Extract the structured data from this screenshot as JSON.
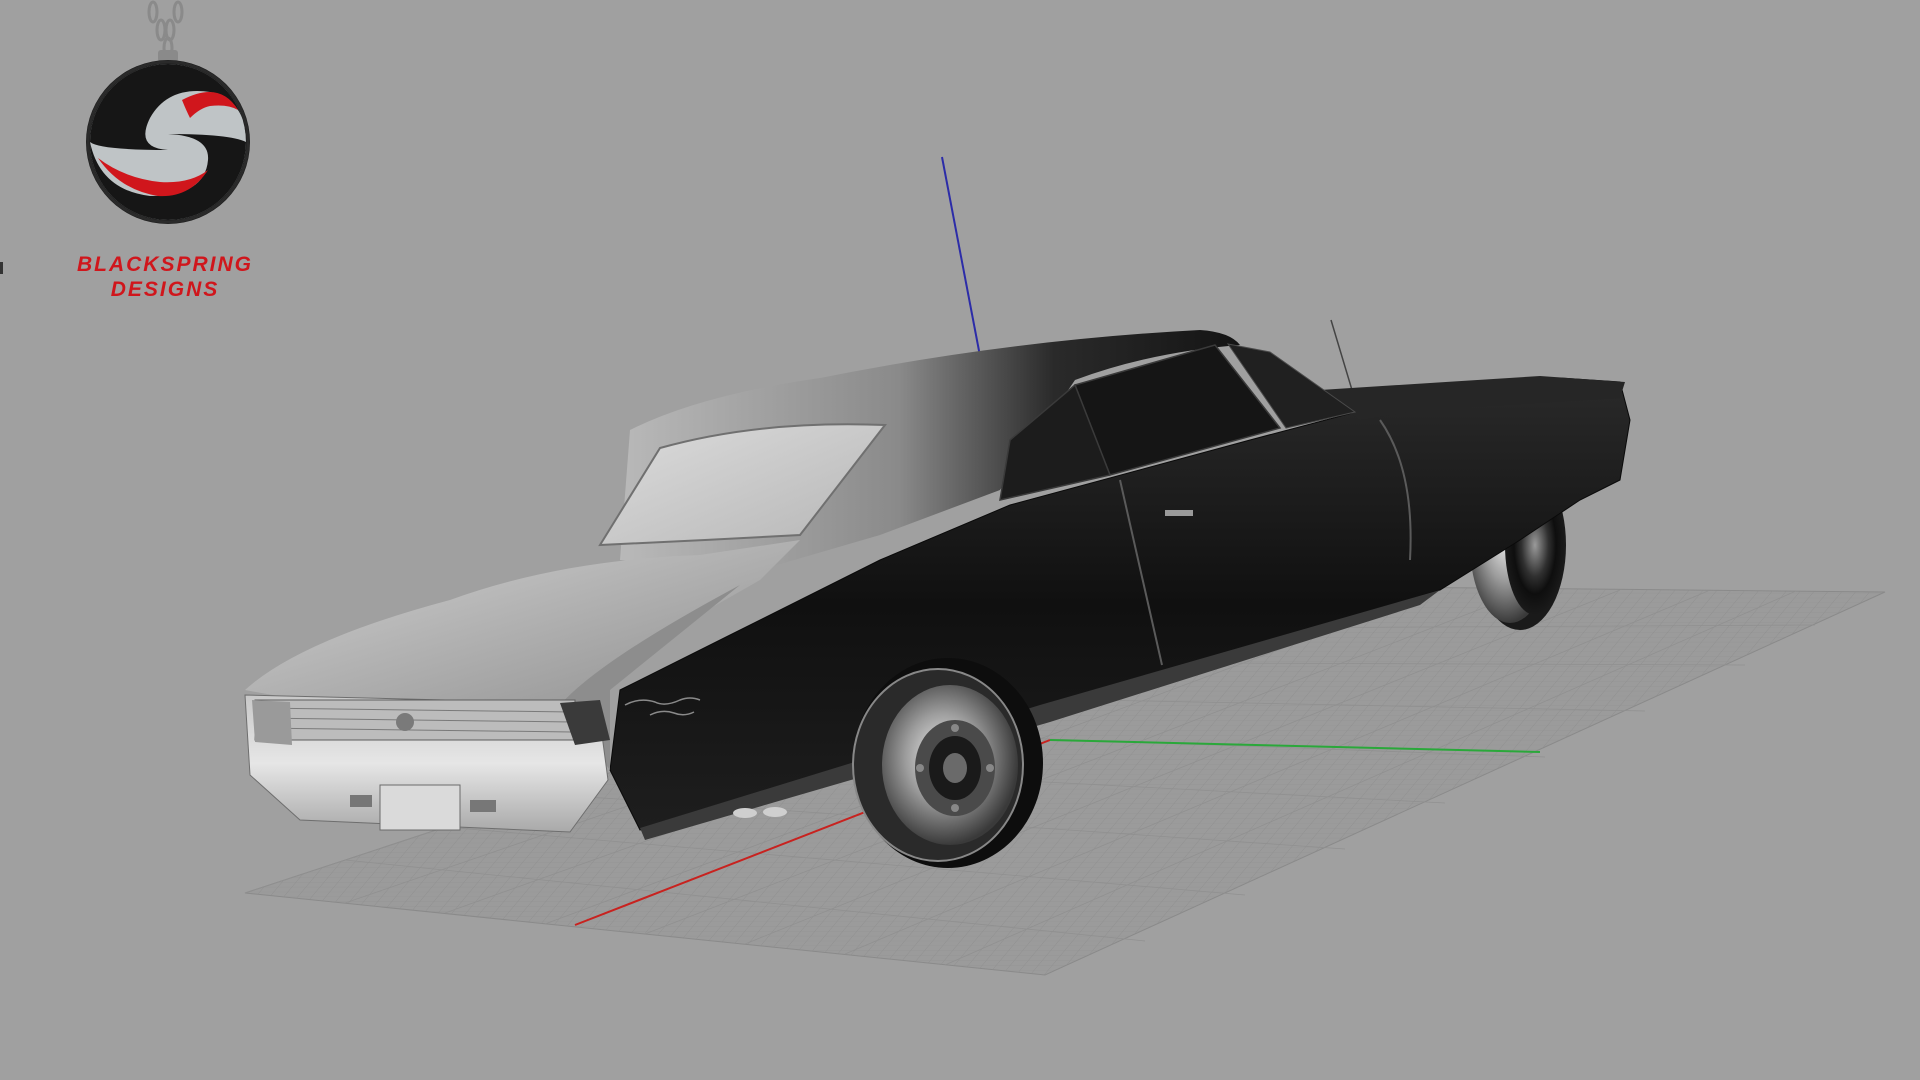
{
  "brand": {
    "line1": "BLACKSPRING",
    "line2": "DESIGNS",
    "colors": {
      "accent_red": "#d0161c",
      "dark": "#1a1a1a",
      "silver": "#bfc4c6"
    }
  },
  "viewport": {
    "background": "#a0a0a0",
    "axes": {
      "x_color": "#cc2222",
      "y_color": "#22aa33",
      "z_color": "#2a2aa8"
    },
    "grid_color": "#8e8e8e"
  },
  "icons": {
    "logo": "blackspring-s-pendant-icon",
    "model": "muscle-car-model"
  }
}
